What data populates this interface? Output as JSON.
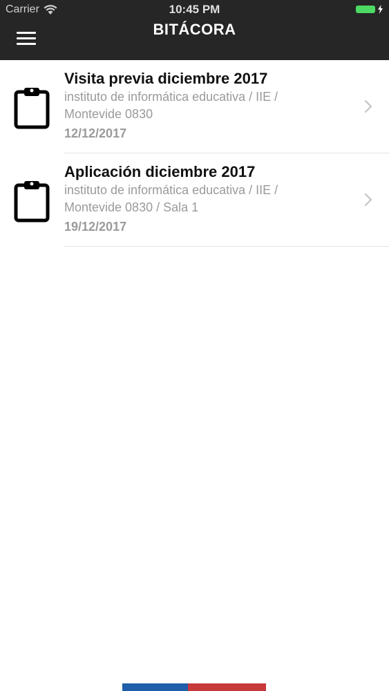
{
  "status_bar": {
    "carrier": "Carrier",
    "time": "10:45 PM",
    "icons": [
      "wifi-icon",
      "battery-icon",
      "charging-bolt-icon"
    ],
    "battery_color": "#4cd964"
  },
  "nav": {
    "title": "BITÁCORA",
    "menu_icon": "hamburger-menu-icon",
    "background": "#262626"
  },
  "entries": [
    {
      "title": "Visita previa diciembre 2017",
      "subtitle_line1": "instituto de informática educativa / IIE /",
      "subtitle_line2": "Montevide 0830",
      "date": "12/12/2017",
      "icon": "clipboard-icon"
    },
    {
      "title": "Aplicación diciembre 2017",
      "subtitle_line1": "instituto de informática educativa / IIE /",
      "subtitle_line2": "Montevide 0830 / Sala 1",
      "date": "19/12/2017",
      "icon": "clipboard-icon"
    }
  ],
  "bottom_bar": {
    "colors": [
      "#1f5ea8",
      "#c8393b"
    ]
  }
}
